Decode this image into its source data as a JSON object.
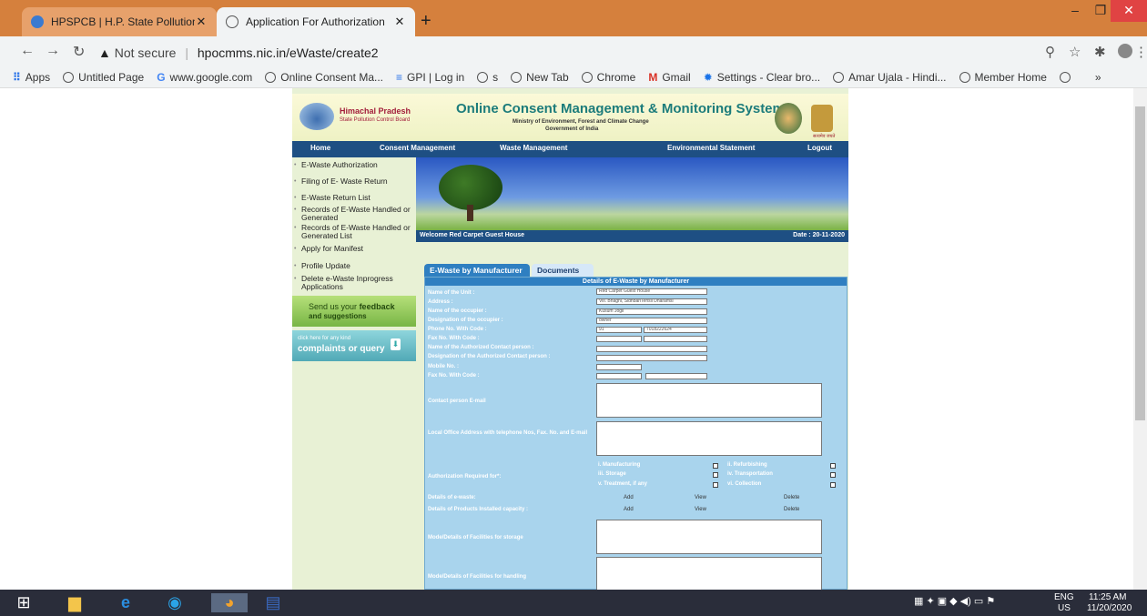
{
  "browser": {
    "tabs": [
      {
        "title": "HPSPCB | H.P. State Pollution Cor"
      },
      {
        "title": "Application For Authorization"
      }
    ],
    "security": "Not secure",
    "url": "hpocmms.nic.in/eWaste/create2",
    "bookmarks": [
      "Apps",
      "Untitled Page",
      "www.google.com",
      "Online Consent Ma...",
      "GPI | Log in",
      "s",
      "New Tab",
      "Chrome",
      "Gmail",
      "Settings - Clear bro...",
      "Amar Ujala - Hindi...",
      "Member Home"
    ]
  },
  "site": {
    "org_line1": "Himachal Pradesh",
    "org_line2": "State Pollution Control Board",
    "title": "Online Consent Management & Monitoring System",
    "ministry1": "Ministry of Environment, Forest and Climate Change",
    "ministry2": "Government of India",
    "emblem_caption": "सत्यमेव जयते",
    "menu": [
      "Home",
      "Consent Management",
      "Waste Management",
      "Environmental Statement",
      "Logout"
    ],
    "sidebar": [
      "E-Waste Authorization",
      "Filing of E- Waste Return",
      "E-Waste Return List",
      "Records of E-Waste Handled or Generated",
      "Records of E-Waste Handled or Generated List",
      "Apply for Manifest",
      "Profile Update",
      "Delete e-Waste Inprogress Applications"
    ],
    "feedback1": "Send us your",
    "feedback_bold": "feedback",
    "feedback2": "and suggestions",
    "complaint1": "click here for any kind",
    "complaint2": "complaints or query",
    "welcome": "Welcome Red Carpet Guest House",
    "date": "Date : 20-11-2020"
  },
  "form": {
    "tabs": [
      "E-Waste by Manufacturer",
      "Documents"
    ],
    "heading": "Details of E-Waste by Manufacturer",
    "labels": {
      "unit": "Name of the Unit :",
      "address": "Address :",
      "occupier": "Name of the occupier :",
      "designation": "Designation of the occupier :",
      "phone": "Phone No. With Code :",
      "fax": "Fax No. With Code :",
      "auth_person": "Name of the Authorized Contact person :",
      "auth_desig": "Designation of the Authorized Contact person :",
      "mobile": "Mobile No. :",
      "fax2": "Fax No. With Code :",
      "email": "Contact person E-mail",
      "local_office": "Local Office Address with telephone Nos, Fax. No. and E-mail",
      "auth_required": "Authorization Required for*:",
      "details_ewaste": "Details of e-waste:",
      "details_products": "Details of Products Installed capacity :",
      "storage": "Mode/Details of Facilities for storage",
      "handling": "Mode/Details of Facilities for handling"
    },
    "values": {
      "unit": "Red Carpet Guest House",
      "address": "Vill. Bhagni, SidhbariTehsil Dharamsl",
      "occupier": "Kusum Jogli",
      "designation": "owner",
      "phone_code": "91",
      "phone_no": "7018222624"
    },
    "auth_options": [
      "i.  Manufacturing",
      "ii.  Refurbishing",
      "iii.  Storage",
      "iv.  Transportation",
      "v.  Treatment, if any",
      "vi.  Collection"
    ],
    "actions": [
      "Add",
      "View",
      "Delete"
    ]
  },
  "taskbar": {
    "lang1": "ENG",
    "lang2": "US",
    "time": "11:25 AM",
    "date": "11/20/2020"
  }
}
